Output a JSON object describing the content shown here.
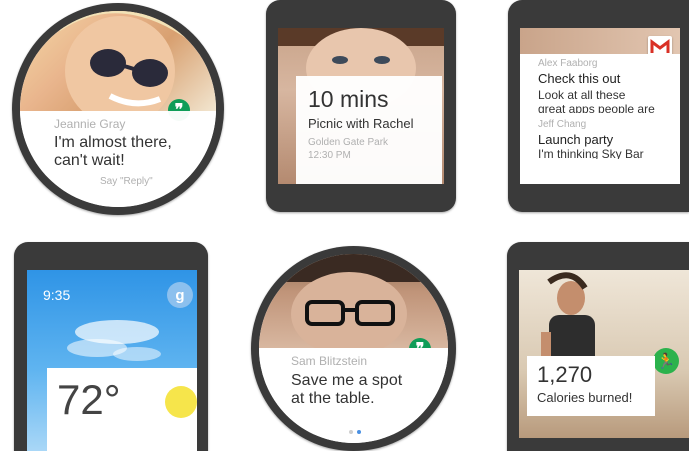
{
  "watch1": {
    "sender": "Jeannie Gray",
    "message_line1": "I'm almost there,",
    "message_line2": "can't wait!",
    "action": "Say \"Reply\"",
    "app_icon": "hangouts-icon",
    "accent_color": "#0f9d58"
  },
  "watch2": {
    "time": "10 mins",
    "event": "Picnic with Rachel",
    "location": "Golden Gate Park",
    "event_time": "12:30 PM"
  },
  "watch3": {
    "app_icon": "gmail-icon",
    "emails": [
      {
        "sender": "Alex Faaborg",
        "subject": "Check this out",
        "preview_line1": "Look at all these",
        "preview_line2": "great apps people are"
      },
      {
        "sender": "Jeff Chang",
        "subject": "Launch party",
        "preview_line1": "I'm thinking Sky Bar"
      }
    ]
  },
  "watch4": {
    "time": "9:35",
    "temperature": "72°",
    "app_icon": "google-search-icon",
    "weather_icon": "sun-icon",
    "sky_color": "#3ba5ec",
    "sun_color": "#f6e54b"
  },
  "watch5": {
    "sender": "Sam Blitzstein",
    "message_line1": "Save me a spot",
    "message_line2": "at the table.",
    "app_icon": "hangouts-icon"
  },
  "watch6": {
    "count": "1,270",
    "label": "Calories burned!",
    "app_icon": "fitness-runner-icon",
    "accent_color": "#2bb24c"
  }
}
